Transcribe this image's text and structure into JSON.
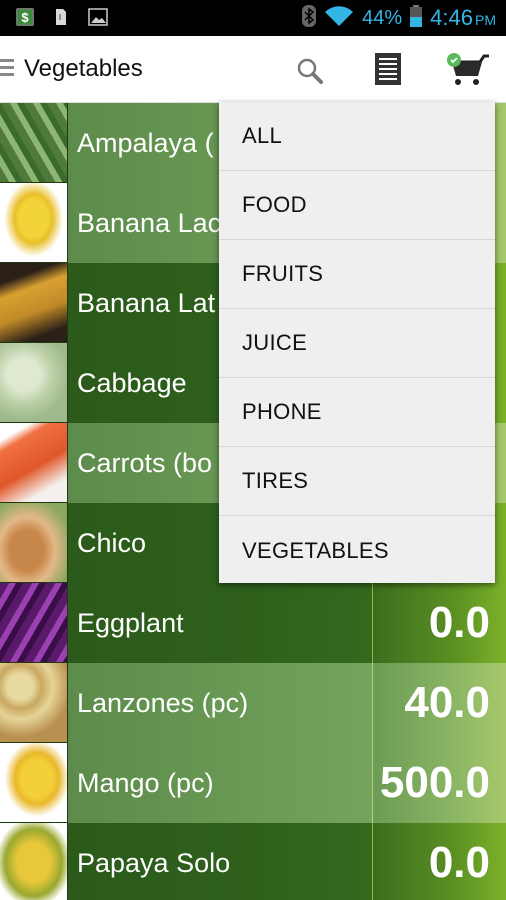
{
  "status_bar": {
    "notification_icons": [
      "money-app-icon",
      "file-icon",
      "image-icon"
    ],
    "system_icons": [
      "bluetooth-icon",
      "wifi-icon",
      "battery-icon"
    ],
    "battery_percent": "44%",
    "time": "4:46",
    "ampm": "PM",
    "accent_color": "#33b5e5"
  },
  "action_bar": {
    "title": "Vegetables",
    "actions": [
      "search-icon",
      "list-icon",
      "cart-icon"
    ]
  },
  "products": [
    {
      "name": "Ampalaya (",
      "value": "",
      "thumb": "ampalaya",
      "shade": "light"
    },
    {
      "name": "Banana Lac",
      "value": "",
      "thumb": "banana-lacatan",
      "shade": "light"
    },
    {
      "name": "Banana Lat",
      "value": "",
      "thumb": "banana-latundan",
      "shade": "dark"
    },
    {
      "name": "Cabbage",
      "value": "",
      "thumb": "cabbage",
      "shade": "dark"
    },
    {
      "name": "Carrots (bo",
      "value": "",
      "thumb": "carrots",
      "shade": "light"
    },
    {
      "name": "Chico",
      "value": "",
      "thumb": "chico",
      "shade": "dark"
    },
    {
      "name": "Eggplant",
      "value": "0.0",
      "thumb": "eggplant",
      "shade": "dark"
    },
    {
      "name": "Lanzones (pc)",
      "value": "40.0",
      "thumb": "lanzones",
      "shade": "light"
    },
    {
      "name": "Mango (pc)",
      "value": "500.0",
      "thumb": "mango",
      "shade": "light"
    },
    {
      "name": "Papaya Solo",
      "value": "0.0",
      "thumb": "papaya",
      "shade": "dark"
    }
  ],
  "dropdown": {
    "items": [
      "ALL",
      "FOOD",
      "FRUITS",
      "JUICE",
      "PHONE",
      "TIRES",
      "VEGETABLES"
    ]
  }
}
